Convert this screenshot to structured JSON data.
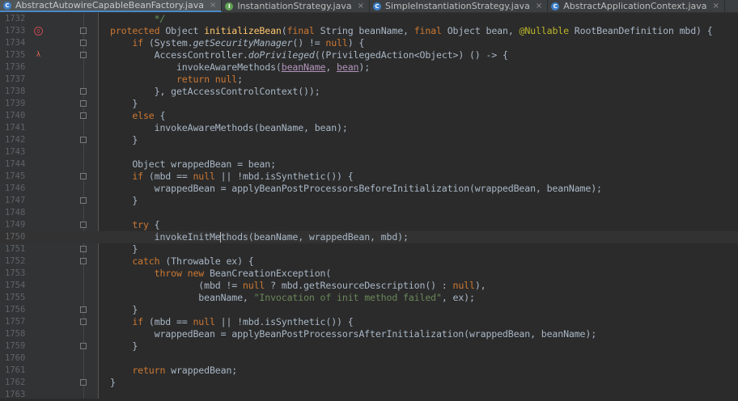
{
  "tabs": [
    {
      "label": "AbstractAutowireCapableBeanFactory.java",
      "icon": "class-icon",
      "active": true,
      "closable": true
    },
    {
      "label": "InstantiationStrategy.java",
      "icon": "interface-icon",
      "active": false,
      "closable": true
    },
    {
      "label": "SimpleInstantiationStrategy.java",
      "icon": "class-icon",
      "active": false,
      "closable": true
    },
    {
      "label": "AbstractApplicationContext.java",
      "icon": "class-icon",
      "active": false,
      "closable": true
    }
  ],
  "tab_icon_glyphs": {
    "class": "C",
    "interface": "I"
  },
  "close_glyph": "×",
  "caret_line": 1750,
  "lines": [
    {
      "n": "1732",
      "tokens": [
        [
          "cm",
          "        */"
        ]
      ]
    },
    {
      "n": "1733",
      "marker": "override",
      "fold": true,
      "tokens": [
        [
          "kw",
          "protected "
        ],
        [
          "",
          "Object "
        ],
        [
          "fn",
          "initializeBean"
        ],
        [
          "",
          "("
        ],
        [
          "kw",
          "final "
        ],
        [
          "",
          "String beanName, "
        ],
        [
          "kw",
          "final "
        ],
        [
          "",
          "Object bean, "
        ],
        [
          "an",
          "@Nullable "
        ],
        [
          "",
          "RootBeanDefinition mbd) {"
        ]
      ]
    },
    {
      "n": "1734",
      "fold": true,
      "tokens": [
        [
          "kw",
          "    if "
        ],
        [
          "",
          "(System."
        ],
        [
          "it",
          "getSecurityManager"
        ],
        [
          "",
          "() != "
        ],
        [
          "kw",
          "null"
        ],
        [
          "",
          ") {"
        ]
      ]
    },
    {
      "n": "1735",
      "marker": "lambda",
      "fold": true,
      "tokens": [
        [
          "",
          "        AccessController."
        ],
        [
          "it",
          "doPrivileged"
        ],
        [
          "",
          "((PrivilegedAction<Object>) () -> {"
        ]
      ]
    },
    {
      "n": "1736",
      "tokens": [
        [
          "",
          "            invokeAwareMethods("
        ],
        [
          "pu",
          "beanName"
        ],
        [
          "",
          ", "
        ],
        [
          "pu",
          "bean"
        ],
        [
          "",
          ");"
        ]
      ]
    },
    {
      "n": "1737",
      "tokens": [
        [
          "kw",
          "            return null"
        ],
        [
          "",
          ";"
        ]
      ]
    },
    {
      "n": "1738",
      "fold": true,
      "tokens": [
        [
          "",
          "        }, getAccessControlContext());"
        ]
      ]
    },
    {
      "n": "1739",
      "fold": true,
      "tokens": [
        [
          "",
          "    }"
        ]
      ]
    },
    {
      "n": "1740",
      "fold": true,
      "tokens": [
        [
          "kw",
          "    else "
        ],
        [
          "",
          "{"
        ]
      ]
    },
    {
      "n": "1741",
      "tokens": [
        [
          "",
          "        invokeAwareMethods(beanName, bean);"
        ]
      ]
    },
    {
      "n": "1742",
      "fold": true,
      "tokens": [
        [
          "",
          "    }"
        ]
      ]
    },
    {
      "n": "1743",
      "tokens": []
    },
    {
      "n": "1744",
      "tokens": [
        [
          "",
          "    Object wrappedBean = bean;"
        ]
      ]
    },
    {
      "n": "1745",
      "fold": true,
      "tokens": [
        [
          "kw",
          "    if "
        ],
        [
          "",
          "(mbd == "
        ],
        [
          "kw",
          "null "
        ],
        [
          "",
          "|| !mbd.isSynthetic()) {"
        ]
      ]
    },
    {
      "n": "1746",
      "tokens": [
        [
          "",
          "        wrappedBean = applyBeanPostProcessorsBeforeInitialization(wrappedBean, beanName);"
        ]
      ]
    },
    {
      "n": "1747",
      "fold": true,
      "tokens": [
        [
          "",
          "    }"
        ]
      ]
    },
    {
      "n": "1748",
      "tokens": []
    },
    {
      "n": "1749",
      "fold": true,
      "tokens": [
        [
          "kw",
          "    try "
        ],
        [
          "",
          "{"
        ]
      ]
    },
    {
      "n": "1750",
      "tokens": [
        [
          "",
          "        invokeInitMe"
        ],
        [
          "cursor",
          ""
        ],
        [
          "",
          "thods(beanName, wrappedBean, mbd);"
        ]
      ]
    },
    {
      "n": "1751",
      "fold": true,
      "tokens": [
        [
          "",
          "    }"
        ]
      ]
    },
    {
      "n": "1752",
      "fold": true,
      "tokens": [
        [
          "kw",
          "    catch "
        ],
        [
          "",
          "(Throwable ex) {"
        ]
      ]
    },
    {
      "n": "1753",
      "tokens": [
        [
          "kw",
          "        throw new "
        ],
        [
          "",
          "BeanCreationException("
        ]
      ]
    },
    {
      "n": "1754",
      "tokens": [
        [
          "",
          "                (mbd != "
        ],
        [
          "kw",
          "null "
        ],
        [
          "",
          "? mbd.getResourceDescription() : "
        ],
        [
          "kw",
          "null"
        ],
        [
          "",
          "),"
        ]
      ]
    },
    {
      "n": "1755",
      "tokens": [
        [
          "",
          "                beanName, "
        ],
        [
          "st",
          "\"Invocation of init method failed\""
        ],
        [
          "",
          ", ex);"
        ]
      ]
    },
    {
      "n": "1756",
      "fold": true,
      "tokens": [
        [
          "",
          "    }"
        ]
      ]
    },
    {
      "n": "1757",
      "fold": true,
      "tokens": [
        [
          "kw",
          "    if "
        ],
        [
          "",
          "(mbd == "
        ],
        [
          "kw",
          "null "
        ],
        [
          "",
          "|| !mbd.isSynthetic()) {"
        ]
      ]
    },
    {
      "n": "1758",
      "tokens": [
        [
          "",
          "        wrappedBean = applyBeanPostProcessorsAfterInitialization(wrappedBean, beanName);"
        ]
      ]
    },
    {
      "n": "1759",
      "fold": true,
      "tokens": [
        [
          "",
          "    }"
        ]
      ]
    },
    {
      "n": "1760",
      "tokens": []
    },
    {
      "n": "1761",
      "tokens": [
        [
          "kw",
          "    return "
        ],
        [
          "",
          "wrappedBean;"
        ]
      ]
    },
    {
      "n": "1762",
      "fold": true,
      "tokens": [
        [
          "",
          "}"
        ]
      ]
    },
    {
      "n": "1763",
      "tokens": []
    }
  ],
  "marker_glyphs": {
    "override": "O",
    "lambda": "λ"
  },
  "colors": {
    "background": "#2b2b2b",
    "gutter": "#313335",
    "keyword": "#cc7832",
    "method_declaration": "#ffc66d",
    "annotation": "#bbb529",
    "string": "#6a8759",
    "comment": "#629755",
    "parameter_in_lambda": "#b294bb",
    "default_text": "#a9b7c6"
  }
}
